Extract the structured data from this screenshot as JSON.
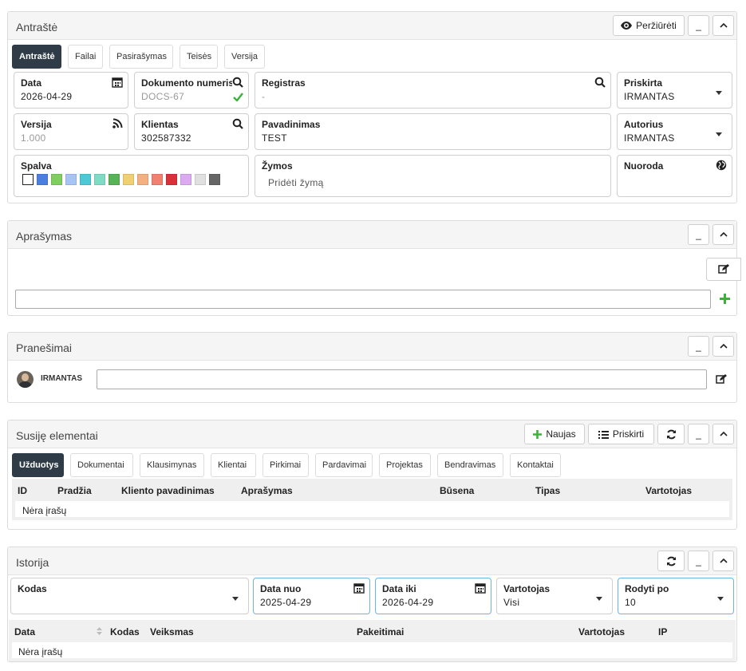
{
  "header_panel": {
    "title": "Antraštė",
    "view_label": "Peržiūrėti",
    "min_label": "_",
    "tabs": [
      "Antraštė",
      "Failai",
      "Pasirašymas",
      "Teisės",
      "Versija"
    ],
    "fields": {
      "data": {
        "label": "Data",
        "value": "2026-04-29"
      },
      "doc_no": {
        "label": "Dokumento numeris",
        "value": "DOCS-67"
      },
      "registras": {
        "label": "Registras",
        "value": "-"
      },
      "priskirta": {
        "label": "Priskirta",
        "value": "IRMANTAS"
      },
      "versija": {
        "label": "Versija",
        "value": "1.000"
      },
      "klientas": {
        "label": "Klientas",
        "value": "302587332"
      },
      "pavadinimas": {
        "label": "Pavadinimas",
        "value": "TEST"
      },
      "autorius": {
        "label": "Autorius",
        "value": "IRMANTAS"
      },
      "spalva": {
        "label": "Spalva"
      },
      "zymos": {
        "label": "Žymos",
        "placeholder": "Pridėti žymą"
      },
      "nuoroda": {
        "label": "Nuoroda"
      }
    },
    "colors": [
      "#ffffff",
      "#4a7fe0",
      "#7fcf5f",
      "#a8c4f4",
      "#4fc8d6",
      "#7fdcc4",
      "#56b356",
      "#f0d070",
      "#f4b07f",
      "#f08070",
      "#d9303a",
      "#dcaaf0",
      "#e0e0e0",
      "#666666"
    ]
  },
  "aprasymas_panel": {
    "title": "Aprašymas",
    "min_label": "_"
  },
  "pranesimai_panel": {
    "title": "Pranešimai",
    "min_label": "_",
    "user": "IRMANTAS"
  },
  "susije_panel": {
    "title": "Susiję elementai",
    "new_label": "Naujas",
    "assign_label": "Priskirti",
    "min_label": "_",
    "tabs": [
      "Užduotys",
      "Dokumentai",
      "Klausimynas",
      "Klientai",
      "Pirkimai",
      "Pardavimai",
      "Projektas",
      "Bendravimas",
      "Kontaktai"
    ],
    "columns": [
      "ID",
      "Pradžia",
      "Kliento pavadinimas",
      "Aprašymas",
      "Būsena",
      "Tipas",
      "Vartotojas"
    ],
    "empty_text": "Nėra įrašų"
  },
  "istorija_panel": {
    "title": "Istorija",
    "min_label": "_",
    "filters": {
      "kodas": {
        "label": "Kodas",
        "value": ""
      },
      "data_nuo": {
        "label": "Data nuo",
        "value": "2025-04-29"
      },
      "data_iki": {
        "label": "Data iki",
        "value": "2026-04-29"
      },
      "vartotojas": {
        "label": "Vartotojas",
        "value": "Visi"
      },
      "rodyti": {
        "label": "Rodyti po",
        "value": "10"
      }
    },
    "columns": [
      "Data",
      "Kodas",
      "Veiksmas",
      "Pakeitimai",
      "Vartotojas",
      "IP"
    ],
    "empty_text": "Nėra įrašų"
  }
}
